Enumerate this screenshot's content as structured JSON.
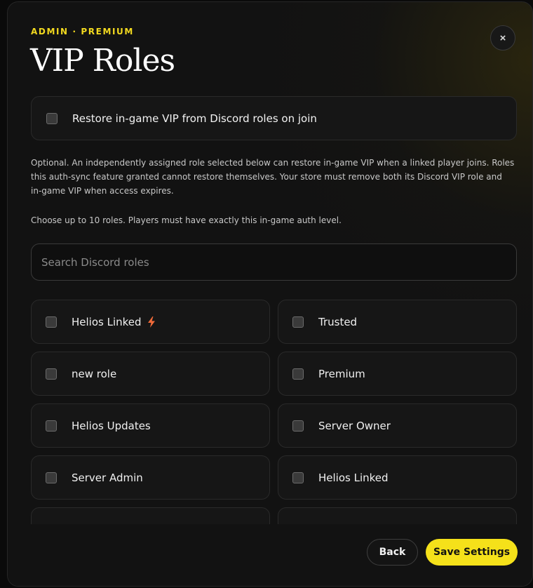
{
  "header": {
    "eyebrow": "ADMIN · PREMIUM",
    "title": "VIP Roles",
    "close_icon": "×"
  },
  "restore": {
    "label": "Restore in-game VIP from Discord roles on join",
    "checked": false
  },
  "description": "Optional. An independently assigned role selected below can restore in-game VIP when a linked player joins. Roles this auth-sync feature granted cannot restore themselves. Your store must remove both its Discord VIP role and in-game VIP when access expires.",
  "limit_note": "Choose up to 10 roles. Players must have exactly this in-game auth level.",
  "search": {
    "placeholder": "Search Discord roles",
    "value": ""
  },
  "roles": [
    {
      "label": "Helios Linked",
      "icon": "lightning-bolt-icon",
      "checked": false
    },
    {
      "label": "Trusted",
      "checked": false
    },
    {
      "label": "new role",
      "checked": false
    },
    {
      "label": "Premium",
      "checked": false
    },
    {
      "label": "Helios Updates",
      "checked": false
    },
    {
      "label": "Server Owner",
      "checked": false
    },
    {
      "label": "Server Admin",
      "checked": false
    },
    {
      "label": "Helios Linked",
      "checked": false
    },
    {
      "label": "",
      "checked": false
    },
    {
      "label": "",
      "checked": false
    }
  ],
  "colors": {
    "accent": "#f5e11a",
    "bolt": "#f26b3a"
  },
  "footer": {
    "back_label": "Back",
    "save_label": "Save Settings"
  }
}
